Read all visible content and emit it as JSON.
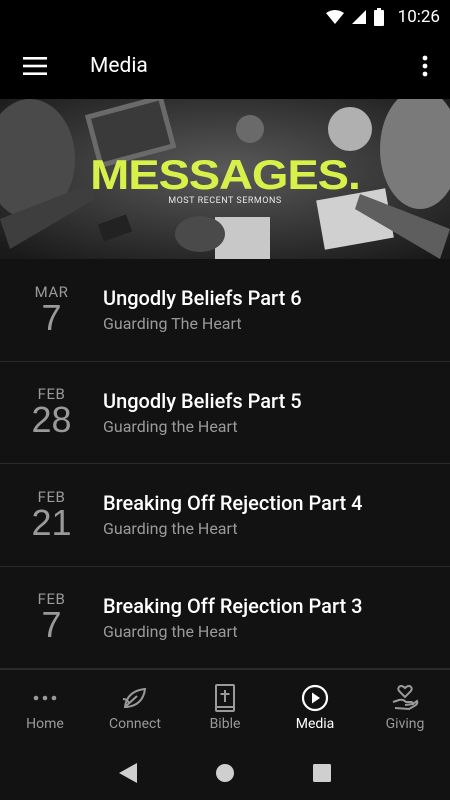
{
  "status_bar": {
    "time": "10:26"
  },
  "app_bar": {
    "title": "Media"
  },
  "banner": {
    "title": "MESSAGES.",
    "subtitle": "MOST RECENT SERMONS",
    "accent_color": "#d8f04a"
  },
  "sermons": [
    {
      "month": "MAR",
      "day": "7",
      "title": "Ungodly Beliefs Part 6",
      "series": "Guarding The Heart"
    },
    {
      "month": "FEB",
      "day": "28",
      "title": "Ungodly Beliefs Part 5",
      "series": "Guarding the Heart"
    },
    {
      "month": "FEB",
      "day": "21",
      "title": "Breaking Off Rejection Part 4",
      "series": "Guarding the Heart"
    },
    {
      "month": "FEB",
      "day": "7",
      "title": "Breaking Off Rejection Part 3",
      "series": "Guarding the Heart"
    }
  ],
  "bottom_nav": {
    "items": [
      {
        "label": "Home",
        "icon": "dots-icon"
      },
      {
        "label": "Connect",
        "icon": "leaf-icon"
      },
      {
        "label": "Bible",
        "icon": "bible-icon"
      },
      {
        "label": "Media",
        "icon": "play-circle-icon",
        "active": true
      },
      {
        "label": "Giving",
        "icon": "heart-hand-icon"
      }
    ]
  }
}
